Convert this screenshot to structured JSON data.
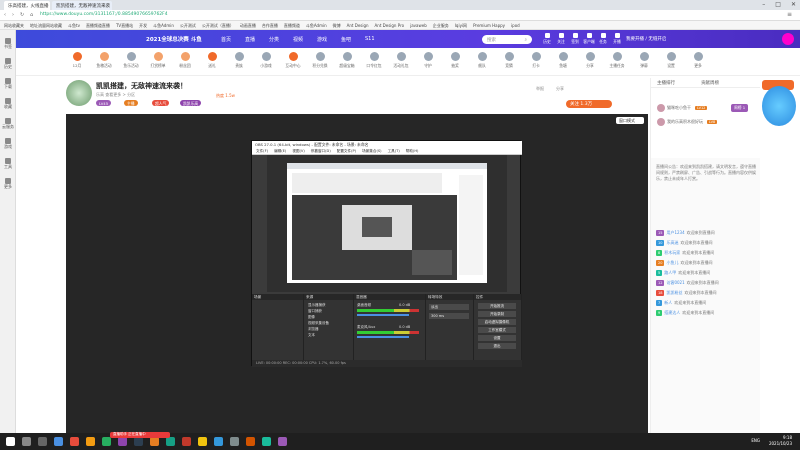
{
  "browser": {
    "tabs": [
      {
        "label": "乐高搭建，火线直播",
        "active": true
      },
      {
        "label": "凯凯搭建，无敌神速流来袭",
        "active": false
      }
    ],
    "url": "https://www.douyu.com/3131167;/0.88549076659762F4",
    "url_prefix": "douyu.com",
    "bookmarks": [
      "网站收藏夹",
      "地址流量网站收藏",
      "斗鱼tv",
      "直播频道直播",
      "TV直播站",
      "开发",
      "斗鱼Admin",
      "公开测试",
      "公开测试（直播）",
      "动画直播",
      "合作直播",
      "直播频道",
      "斗鱼Admin",
      "微博",
      "Ant Design",
      "Ant Design Pro",
      "javaweb",
      "企业服务",
      "Iqiyi网",
      "Premium Happy",
      "ipod"
    ]
  },
  "leftbar": {
    "items": [
      "书签",
      "历史",
      "下载",
      "收藏",
      "云服务",
      "游戏",
      "工具",
      "更多"
    ]
  },
  "site": {
    "logo": "2021全球总决赛 斗鱼",
    "nav": [
      "首页",
      "直播",
      "分类",
      "视频",
      "游戏",
      "鱼吧",
      "S11"
    ],
    "search_placeholder": "搜索",
    "right_icons": [
      "历史",
      "关注",
      "签到",
      "客户端",
      "任务",
      "开播"
    ],
    "user_btn": "我要开播 / 无缝开启"
  },
  "categories": [
    {
      "label": "12月",
      "color": "#f06a2a"
    },
    {
      "label": "鱼粮活动",
      "color": "#f3a26b"
    },
    {
      "label": "鱼乐活动",
      "color": "#9aa7b5"
    },
    {
      "label": "打赏榜单",
      "color": "#f3a26b"
    },
    {
      "label": "粉丝团",
      "color": "#f3a26b"
    },
    {
      "label": "送礼",
      "color": "#f06a2a"
    },
    {
      "label": "贵族",
      "color": "#9aa7b5"
    },
    {
      "label": "小游戏",
      "color": "#9aa7b5"
    },
    {
      "label": "互动中心",
      "color": "#f06a2a"
    },
    {
      "label": "积分兑换",
      "color": "#9aa7b5"
    },
    {
      "label": "超级宝箱",
      "color": "#9aa7b5"
    },
    {
      "label": "口令红包",
      "color": "#9aa7b5"
    },
    {
      "label": "活动礼包",
      "color": "#9aa7b5"
    },
    {
      "label": "守护",
      "color": "#9aa7b5"
    },
    {
      "label": "抽奖",
      "color": "#9aa7b5"
    },
    {
      "label": "舰队",
      "color": "#9aa7b5"
    },
    {
      "label": "竞猜",
      "color": "#9aa7b5"
    },
    {
      "label": "打卡",
      "color": "#9aa7b5"
    },
    {
      "label": "鱼塘",
      "color": "#9aa7b5"
    },
    {
      "label": "分享",
      "color": "#9aa7b5"
    },
    {
      "label": "主播任务",
      "color": "#9aa7b5"
    },
    {
      "label": "弹幕",
      "color": "#9aa7b5"
    },
    {
      "label": "设置",
      "color": "#9aa7b5"
    },
    {
      "label": "更多",
      "color": "#9aa7b5"
    }
  ],
  "room": {
    "title": "凯凯搭建，无敌神速流来袭！",
    "meta": "乐高  查看更多  >  分区",
    "hot_label": "热度 1.5w",
    "tags": [
      {
        "label": "LV45",
        "color": "#9b59b6"
      },
      {
        "label": "主播",
        "color": "#e67e22"
      },
      {
        "label": "超人气",
        "color": "#e74c3c"
      },
      {
        "label": "凯凯乐高",
        "color": "#8e44ad"
      }
    ],
    "follow_label": "关注 1.3万",
    "report": "举报",
    "share": "分享"
  },
  "player": {
    "ctl_label": "窗口模式"
  },
  "obs": {
    "title": "OBS 27.0.1 (64-bit, windows) - 配置文件: 未命名 - 场景: 未命名",
    "menu": [
      "文件(F)",
      "编辑(E)",
      "视图(V)",
      "停靠窗口(D)",
      "配置文件(P)",
      "场景集合(S)",
      "工具(T)",
      "帮助(H)"
    ],
    "docks": [
      {
        "name": "场景"
      },
      {
        "name": "来源"
      },
      {
        "name": "混音器"
      },
      {
        "name": "转场特效"
      },
      {
        "name": "控件"
      }
    ],
    "sources": [
      "显示器捕获",
      "窗口捕获",
      "图像",
      "视频采集设备",
      "浏览器",
      "文本"
    ],
    "mixer": [
      {
        "label": "桌面音频",
        "db": "0.0 dB"
      },
      {
        "label": "麦克风/Aux",
        "db": "0.0 dB"
      }
    ],
    "transition": {
      "label": "淡出",
      "duration": "300 ms"
    },
    "controls": [
      "开始推流",
      "开始录制",
      "启动虚拟摄像机",
      "工作室模式",
      "设置",
      "退出"
    ],
    "status": "LIVE: 00:00:00  REC: 00:00:00  CPU: 1.7%, 60.00 fps"
  },
  "right_panel": {
    "tabs": [
      "主播排行",
      "贡献周榜"
    ],
    "rank_badge": "周榜 1",
    "rank_rows": [
      {
        "name": "猫咪吃小鱼干",
        "badge": "LV12"
      },
      {
        "name": "我的乐高积木很好玩",
        "badge": "LV8"
      }
    ],
    "chat_notice": "直播间公告：欢迎来到凯凯搭建，请文明发言，遵守直播间规则，严禁刷屏、广告、引战等行为。直播内容仅供娱乐，禁止未成年人打赏。",
    "chat": [
      {
        "lv": "15",
        "lv_color": "#9b59b6",
        "user": "用户1234",
        "msg": "欢迎来到直播间"
      },
      {
        "lv": "10",
        "lv_color": "#3498db",
        "user": "乐高迷",
        "msg": "欢迎来到本直播间"
      },
      {
        "lv": "8",
        "lv_color": "#2ecc71",
        "user": "积木玩家",
        "msg": "欢迎来到本直播间"
      },
      {
        "lv": "20",
        "lv_color": "#e67e22",
        "user": "小鱼儿",
        "msg": "欢迎来到本直播间"
      },
      {
        "lv": "5",
        "lv_color": "#1abc9c",
        "user": "路人甲",
        "msg": "欢迎来到本直播间"
      },
      {
        "lv": "12",
        "lv_color": "#9b59b6",
        "user": "访客0021",
        "msg": "欢迎来到本直播间"
      },
      {
        "lv": "18",
        "lv_color": "#e74c3c",
        "user": "凯凯粉丝",
        "msg": "欢迎来到本直播间"
      },
      {
        "lv": "7",
        "lv_color": "#3498db",
        "user": "新人",
        "msg": "欢迎来到本直播间"
      },
      {
        "lv": "9",
        "lv_color": "#2ecc71",
        "user": "搭建达人",
        "msg": "欢迎来到本直播间"
      }
    ]
  },
  "taskbar": {
    "banner": "直播助手 正在直播中",
    "time": "9:18",
    "date": "2021/10/23",
    "lang": "ENG"
  }
}
